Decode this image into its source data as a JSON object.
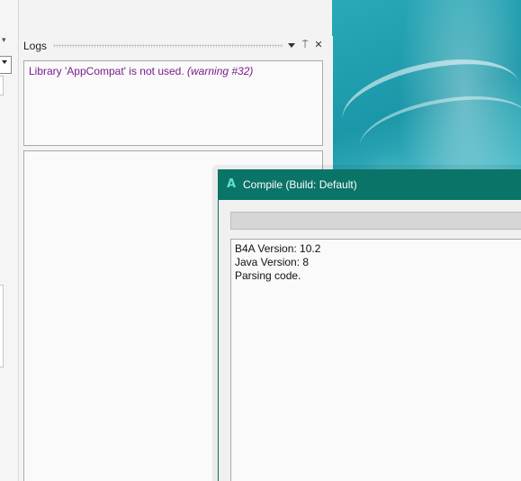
{
  "logs_panel": {
    "title": "Logs",
    "buttons": {
      "pin": "⍑",
      "close": "✕"
    },
    "messages": [
      {
        "text": "Library 'AppCompat' is not used. ",
        "detail": "(warning #32)",
        "color": "#7a1e8c"
      }
    ]
  },
  "compile_dialog": {
    "title": "Compile (Build: Default)",
    "icon_letter": "A",
    "progress_fraction": 0,
    "output_lines": [
      "B4A Version: 10.2",
      "Java Version: 8",
      "Parsing code."
    ],
    "colors": {
      "titlebar": "#0b7468",
      "icon": "#5ee0d0"
    }
  },
  "left_strip": {
    "menu_glyph": "▾"
  }
}
